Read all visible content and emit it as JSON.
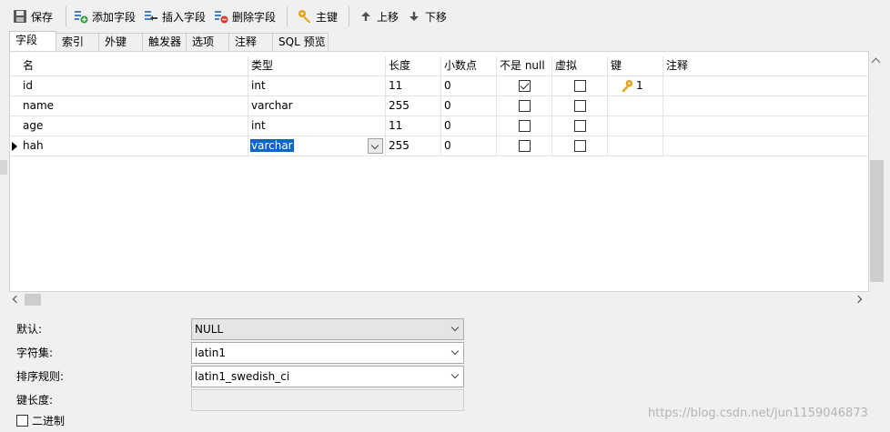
{
  "toolbar": {
    "save": "保存",
    "add_field": "添加字段",
    "insert_field": "插入字段",
    "delete_field": "删除字段",
    "primary_key": "主键",
    "move_up": "上移",
    "move_down": "下移"
  },
  "tabs": [
    "字段",
    "索引",
    "外键",
    "触发器",
    "选项",
    "注释",
    "SQL 预览"
  ],
  "grid": {
    "headers": [
      "名",
      "类型",
      "长度",
      "小数点",
      "不是 null",
      "虚拟",
      "键",
      "注释"
    ],
    "rows": [
      {
        "name": "id",
        "type": "int",
        "length": "11",
        "decimals": "0",
        "not_null": true,
        "virtual": false,
        "key": "1"
      },
      {
        "name": "name",
        "type": "varchar",
        "length": "255",
        "decimals": "0",
        "not_null": false,
        "virtual": false,
        "key": ""
      },
      {
        "name": "age",
        "type": "int",
        "length": "11",
        "decimals": "0",
        "not_null": false,
        "virtual": false,
        "key": ""
      },
      {
        "name": "hah",
        "type": "varchar",
        "length": "255",
        "decimals": "0",
        "not_null": false,
        "virtual": false,
        "key": ""
      }
    ]
  },
  "properties": {
    "default_label": "默认:",
    "default_value": "NULL",
    "charset_label": "字符集:",
    "charset_value": "latin1",
    "collation_label": "排序规则:",
    "collation_value": "latin1_swedish_ci",
    "key_length_label": "键长度:",
    "binary_label": "二进制"
  },
  "watermark": "https://blog.csdn.net/jun1159046873",
  "colors": {
    "selection": "#0a64d0",
    "key_icon": "#e6a11a",
    "add_icon": "#2e9e3c",
    "delete_icon": "#d83b2a"
  }
}
